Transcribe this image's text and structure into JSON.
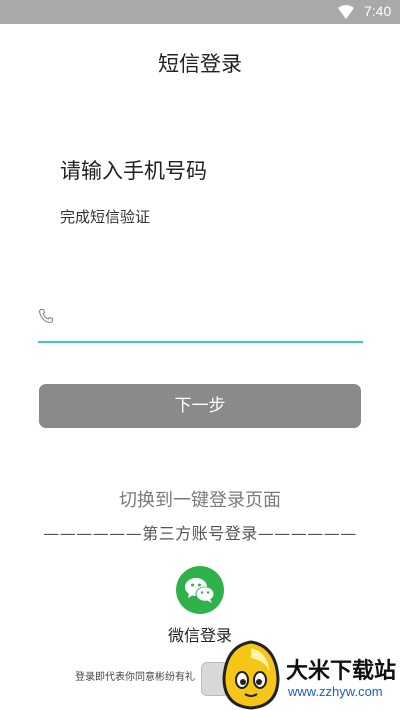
{
  "status_bar": {
    "time": "7:40"
  },
  "page": {
    "title": "短信登录"
  },
  "form": {
    "heading": "请输入手机号码",
    "subheading": "完成短信验证",
    "phone_value": "",
    "phone_placeholder": "",
    "next_label": "下一步"
  },
  "links": {
    "one_click_login": "切换到一键登录页面"
  },
  "third_party": {
    "divider": "——————第三方账号登录——————",
    "wechat_label": "微信登录"
  },
  "agreement": {
    "text": "登录即代表你同意彬纷有礼"
  },
  "watermark": {
    "name": "大米下载站",
    "url": "www.zzhyw.com"
  },
  "colors": {
    "status_bar": "#a9a9a9",
    "accent_underline": "#3cc9c1",
    "button_disabled": "#8a8a8a",
    "wechat_green": "#2fb24c",
    "link_gray": "#7a7a7a"
  }
}
